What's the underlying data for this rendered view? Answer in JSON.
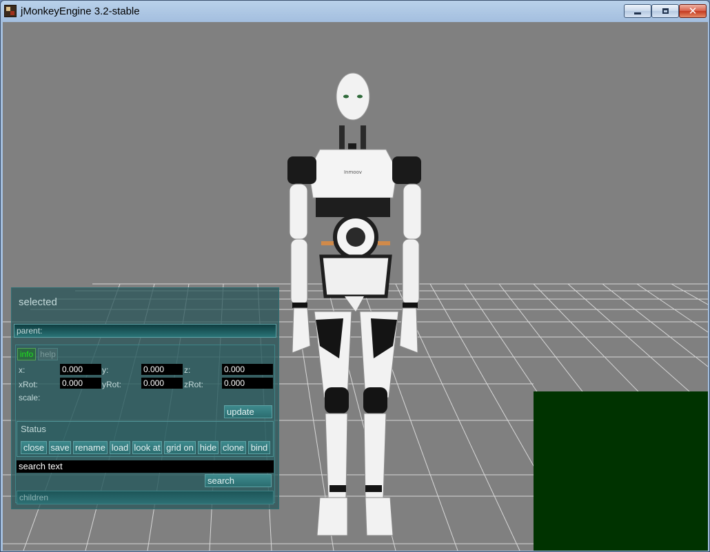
{
  "window": {
    "title": "jMonkeyEngine 3.2-stable",
    "icon": "jmonkey-app-icon",
    "controls": {
      "minimize": "minimize-icon",
      "maximize": "maximize-icon",
      "close": "close-icon",
      "close_glyph": "✕"
    }
  },
  "scene": {
    "background": "#808080",
    "grid_color": "#d9d9d9",
    "overlay_color": "#003300",
    "robot_chest_text": "Inmoov"
  },
  "panel": {
    "title": "selected",
    "parent_label": "parent:",
    "tabs": [
      {
        "label": "info",
        "active": true
      },
      {
        "label": "help",
        "active": false
      }
    ],
    "transform": {
      "x_label": "x:",
      "x_value": "0.000",
      "y_label": "y:",
      "y_value": "0.000",
      "z_label": "z:",
      "z_value": "0.000",
      "xrot_label": "xRot:",
      "xrot_value": "0.000",
      "yrot_label": "yRot:",
      "yrot_value": "0.000",
      "zrot_label": "zRot:",
      "zrot_value": "0.000",
      "scale_label": "scale:"
    },
    "update_button": "update",
    "status_label": "Status",
    "actions": [
      "close",
      "save",
      "rename",
      "load",
      "look at",
      "grid on",
      "hide",
      "clone",
      "bind"
    ],
    "search_value": "search text",
    "search_button": "search",
    "children_label": "children",
    "colors": {
      "active_tab": "#1fe01f",
      "inactive_tab": "#7a9a9a",
      "accent": "#2b6d70"
    }
  }
}
